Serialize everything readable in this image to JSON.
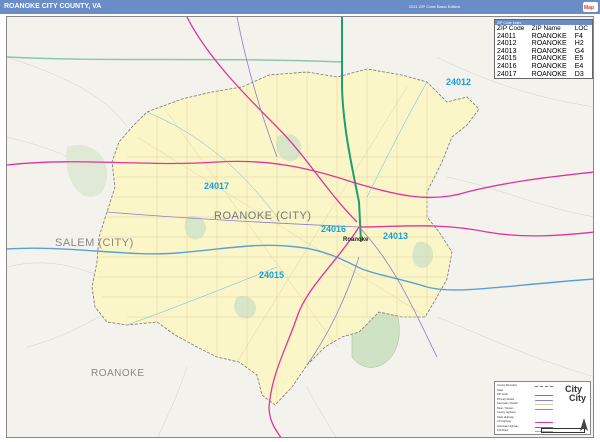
{
  "title": "ROANOKE CITY COUNTY, VA",
  "edition": "2021 ZIP Code Basic Edition",
  "zip_table": {
    "title": "ZIP Code Index",
    "headers": [
      "ZIP Code",
      "ZIP Name",
      "LOC"
    ],
    "rows": [
      {
        "zip": "24011",
        "name": "ROANOKE",
        "loc": "F4"
      },
      {
        "zip": "24012",
        "name": "ROANOKE",
        "loc": "H2"
      },
      {
        "zip": "24013",
        "name": "ROANOKE",
        "loc": "G4"
      },
      {
        "zip": "24015",
        "name": "ROANOKE",
        "loc": "E5"
      },
      {
        "zip": "24016",
        "name": "ROANOKE",
        "loc": "E4"
      },
      {
        "zip": "24017",
        "name": "ROANOKE",
        "loc": "D3"
      }
    ]
  },
  "labels": {
    "city": "ROANOKE (CITY)",
    "salem": "SALEM (CITY)",
    "county": "ROANOKE",
    "downtown": "Roanoke",
    "zips": [
      "24012",
      "24017",
      "24016",
      "24013",
      "24015"
    ]
  },
  "legend": {
    "items": [
      "County Boundary",
      "State",
      "ZIP Code",
      "Primary Roads",
      "Secondary Roads",
      "River / Stream",
      "County Highway",
      "State Highway",
      "US Highway",
      "Interstate Highway",
      "Toll Road"
    ]
  },
  "logo": {
    "line1": "City",
    "line2": "City"
  },
  "colors": {
    "title_bar": "#6a8cc7",
    "city_fill": "#fbf6c7",
    "zip_label": "#1aa0d8",
    "interstate": "#1f9e6f",
    "us_highway": "#e0339b",
    "water": "#5aa0d8",
    "park": "#cfe3c4"
  }
}
